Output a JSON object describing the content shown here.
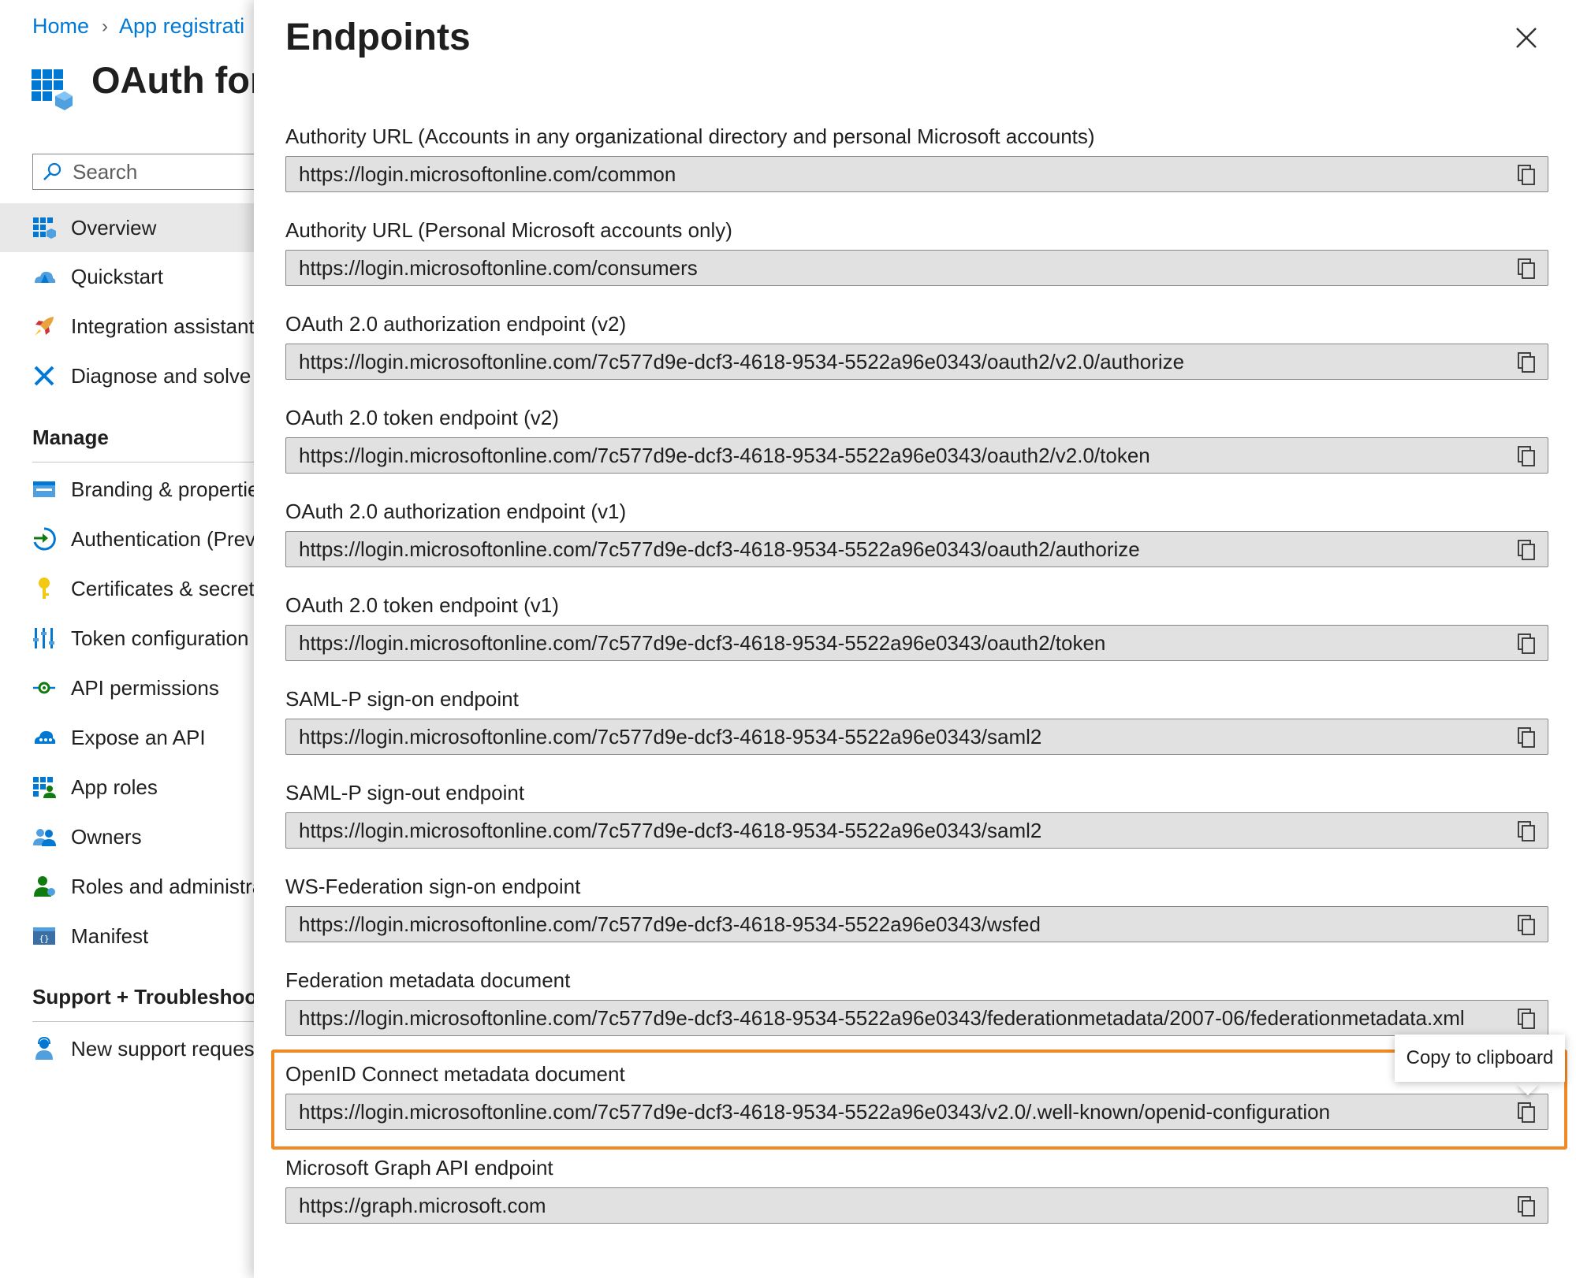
{
  "breadcrumb": {
    "home": "Home",
    "current": "App registrati"
  },
  "app": {
    "title": "OAuth for"
  },
  "search": {
    "placeholder": "Search"
  },
  "nav": {
    "top_items": [
      {
        "label": "Overview",
        "icon": "overview-icon",
        "selected": true
      },
      {
        "label": "Quickstart",
        "icon": "quickstart-icon"
      },
      {
        "label": "Integration assistant",
        "icon": "rocket-icon"
      },
      {
        "label": "Diagnose and solve p",
        "icon": "wrench-icon"
      }
    ],
    "manage_header": "Manage",
    "manage_items": [
      {
        "label": "Branding & propertie",
        "icon": "branding-icon"
      },
      {
        "label": "Authentication (Previ",
        "icon": "authentication-icon"
      },
      {
        "label": "Certificates & secrets",
        "icon": "key-icon"
      },
      {
        "label": "Token configuration",
        "icon": "token-icon"
      },
      {
        "label": "API permissions",
        "icon": "api-permissions-icon"
      },
      {
        "label": "Expose an API",
        "icon": "cloud-icon"
      },
      {
        "label": "App roles",
        "icon": "app-roles-icon"
      },
      {
        "label": "Owners",
        "icon": "owners-icon"
      },
      {
        "label": "Roles and administra",
        "icon": "roles-icon"
      },
      {
        "label": "Manifest",
        "icon": "manifest-icon"
      }
    ],
    "support_header": "Support + Troubleshoot",
    "support_items": [
      {
        "label": "New support request",
        "icon": "support-icon"
      }
    ]
  },
  "panel": {
    "title": "Endpoints",
    "endpoints": [
      {
        "label": "Authority URL (Accounts in any organizational directory and personal Microsoft accounts)",
        "value": "https://login.microsoftonline.com/common"
      },
      {
        "label": "Authority URL (Personal Microsoft accounts only)",
        "value": "https://login.microsoftonline.com/consumers"
      },
      {
        "label": "OAuth 2.0 authorization endpoint (v2)",
        "value": "https://login.microsoftonline.com/7c577d9e-dcf3-4618-9534-5522a96e0343/oauth2/v2.0/authorize"
      },
      {
        "label": "OAuth 2.0 token endpoint (v2)",
        "value": "https://login.microsoftonline.com/7c577d9e-dcf3-4618-9534-5522a96e0343/oauth2/v2.0/token"
      },
      {
        "label": "OAuth 2.0 authorization endpoint (v1)",
        "value": "https://login.microsoftonline.com/7c577d9e-dcf3-4618-9534-5522a96e0343/oauth2/authorize"
      },
      {
        "label": "OAuth 2.0 token endpoint (v1)",
        "value": "https://login.microsoftonline.com/7c577d9e-dcf3-4618-9534-5522a96e0343/oauth2/token"
      },
      {
        "label": "SAML-P sign-on endpoint",
        "value": "https://login.microsoftonline.com/7c577d9e-dcf3-4618-9534-5522a96e0343/saml2"
      },
      {
        "label": "SAML-P sign-out endpoint",
        "value": "https://login.microsoftonline.com/7c577d9e-dcf3-4618-9534-5522a96e0343/saml2"
      },
      {
        "label": "WS-Federation sign-on endpoint",
        "value": "https://login.microsoftonline.com/7c577d9e-dcf3-4618-9534-5522a96e0343/wsfed"
      },
      {
        "label": "Federation metadata document",
        "value": "https://login.microsoftonline.com/7c577d9e-dcf3-4618-9534-5522a96e0343/federationmetadata/2007-06/federationmetadata.xml"
      },
      {
        "label": "OpenID Connect metadata document",
        "value": "https://login.microsoftonline.com/7c577d9e-dcf3-4618-9534-5522a96e0343/v2.0/.well-known/openid-configuration",
        "highlighted": true
      },
      {
        "label": "Microsoft Graph API endpoint",
        "value": "https://graph.microsoft.com"
      }
    ],
    "tooltip": "Copy to clipboard"
  },
  "colors": {
    "link": "#0078d4",
    "highlight": "#f08a24",
    "field_bg": "#e1e1e1"
  }
}
